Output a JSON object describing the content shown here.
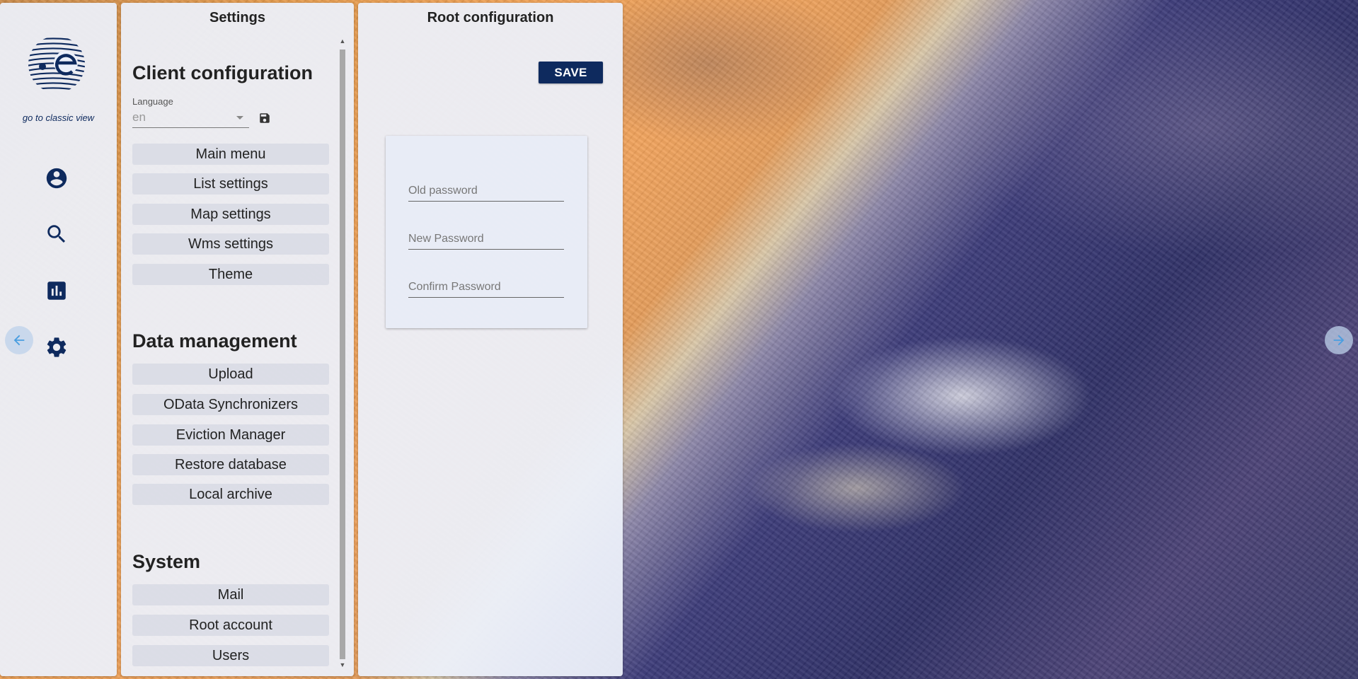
{
  "nav": {
    "classic_view_link": "go to classic view",
    "icons": [
      "account-icon",
      "search-icon",
      "bar-chart-icon",
      "gear-icon"
    ]
  },
  "settings": {
    "title": "Settings",
    "client_section": {
      "title": "Client configuration",
      "language_label": "Language",
      "language_value": "en",
      "items": [
        "Main menu",
        "List settings",
        "Map settings",
        "Wms settings",
        "Theme"
      ]
    },
    "data_section": {
      "title": "Data management",
      "items": [
        "Upload",
        "OData Synchronizers",
        "Eviction Manager",
        "Restore database",
        "Local archive"
      ]
    },
    "system_section": {
      "title": "System",
      "items": [
        "Mail",
        "Root account",
        "Users"
      ]
    }
  },
  "root_config": {
    "title": "Root configuration",
    "save_label": "SAVE",
    "old_password_placeholder": "Old password",
    "new_password_placeholder": "New Password",
    "confirm_password_placeholder": "Confirm Password"
  },
  "colors": {
    "brand": "#0e2a5e",
    "panel_bg": "#ecf0fa",
    "arrow_accent": "#4a9ee0"
  }
}
